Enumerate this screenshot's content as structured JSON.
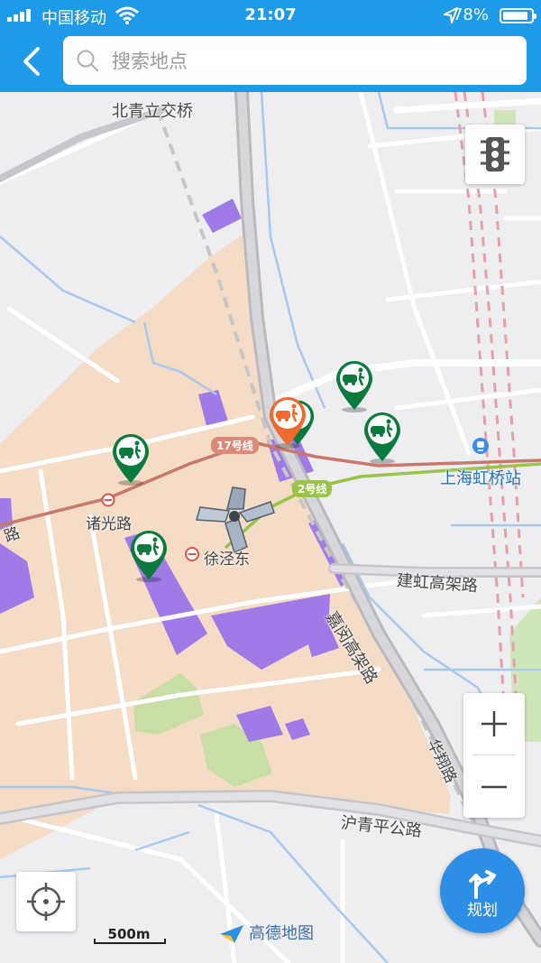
{
  "status": {
    "carrier": "中国移动",
    "time": "21:07",
    "battery": "78%",
    "battery_level": 0.78
  },
  "search": {
    "placeholder": "搜索地点"
  },
  "map": {
    "labels": {
      "bridge": "北青立交桥",
      "station_hongqiao": "上海虹桥站",
      "zhuguang": "诸光路",
      "xujing": "徐泾东",
      "jianhong": "建虹高架路",
      "jiamin": "嘉闵高架路",
      "huqingping": "沪青平公路",
      "road_fragment": "路",
      "hua_fragment": "华翔路"
    },
    "lines": {
      "line17": "17号线",
      "line2": "2号线"
    },
    "poi_icons": [
      "taxi-pedestrian-pin",
      "taxi-pedestrian-pin",
      "taxi-pedestrian-pin",
      "taxi-pedestrian-pin",
      "taxi-pedestrian-pin-orange"
    ]
  },
  "controls": {
    "plan": "规划",
    "scale": "500m",
    "zoom_in": "+",
    "zoom_out": "−"
  },
  "brand": "高德地图",
  "colors": {
    "header": "#1d9ae8",
    "area": "#f4dcc6",
    "purple": "#a07ae6",
    "green": "#0a7a3e",
    "orange": "#ef6a2c",
    "line17": "#c9786a",
    "line2": "#9ac34a"
  }
}
